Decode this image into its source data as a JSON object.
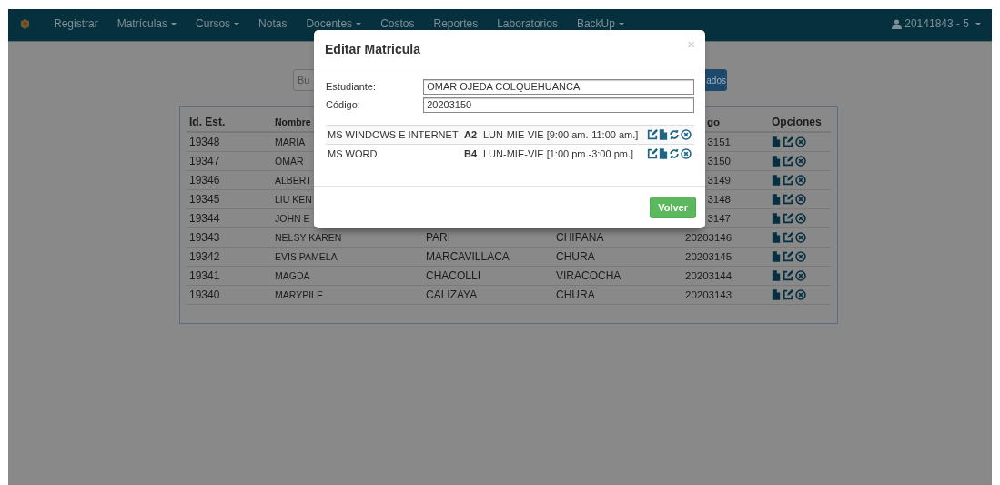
{
  "navbar": {
    "items": [
      {
        "label": "Registrar",
        "dropdown": false
      },
      {
        "label": "Matrículas",
        "dropdown": true
      },
      {
        "label": "Cursos",
        "dropdown": true
      },
      {
        "label": "Notas",
        "dropdown": false
      },
      {
        "label": "Docentes",
        "dropdown": true
      },
      {
        "label": "Costos",
        "dropdown": false
      },
      {
        "label": "Reportes",
        "dropdown": false
      },
      {
        "label": "Laboratorios",
        "dropdown": false
      },
      {
        "label": "BackUp",
        "dropdown": true
      }
    ],
    "user": {
      "label": "20141843 - 5",
      "dropdown": true
    }
  },
  "search": {
    "placeholder": "Bu",
    "button": "ados"
  },
  "table": {
    "header": {
      "column_1": "Id. Est.",
      "column_2": "Nombre",
      "column_5": "go",
      "column_6": "Opciones"
    },
    "rows": [
      {
        "column_1": "19348",
        "column_2": "MARIA",
        "column_5": "3151"
      },
      {
        "column_1": "19347",
        "column_2": "OMAR",
        "column_5": "3150"
      },
      {
        "column_1": "19346",
        "column_2": "ALBERT",
        "column_5": "3149"
      },
      {
        "column_1": "19345",
        "column_2": "LIU KEN",
        "column_5": "3148"
      },
      {
        "column_1": "19344",
        "column_2": "JOHN E",
        "column_5": "3147"
      },
      {
        "column_1": "19343",
        "column_2": "NELSY KAREN",
        "column_3": "PARI",
        "column_4": "CHIPANA",
        "column_5": "20203146"
      },
      {
        "column_1": "19342",
        "column_2": "EVIS PAMELA",
        "column_3": "MARCAVILLACA",
        "column_4": "CHURA",
        "column_5": "20203145"
      },
      {
        "column_1": "19341",
        "column_2": "MAGDA",
        "column_3": "CHACOLLI",
        "column_4": "VIRACOCHA",
        "column_5": "20203144"
      },
      {
        "column_1": "19340",
        "column_2": "MARYPILE",
        "column_3": "CALIZAYA",
        "column_4": "CHURA",
        "column_5": "20203143"
      }
    ]
  },
  "modal": {
    "title": "Editar Matricula",
    "close": "×",
    "fields": [
      {
        "label": "Estudiante:",
        "value": "OMAR OJEDA COLQUEHUANCA"
      },
      {
        "label": "Código:",
        "value": "20203150"
      }
    ],
    "courses": [
      {
        "name": "MS WINDOWS E INTERNET",
        "group": "A2",
        "schedule": "LUN-MIE-VIE [9:00 am.-11:00 am.]"
      },
      {
        "name": "MS WORD",
        "group": "B4",
        "schedule": "LUN-MIE-VIE [1:00 pm.-3:00 pm.]"
      }
    ],
    "button": "Volver"
  }
}
